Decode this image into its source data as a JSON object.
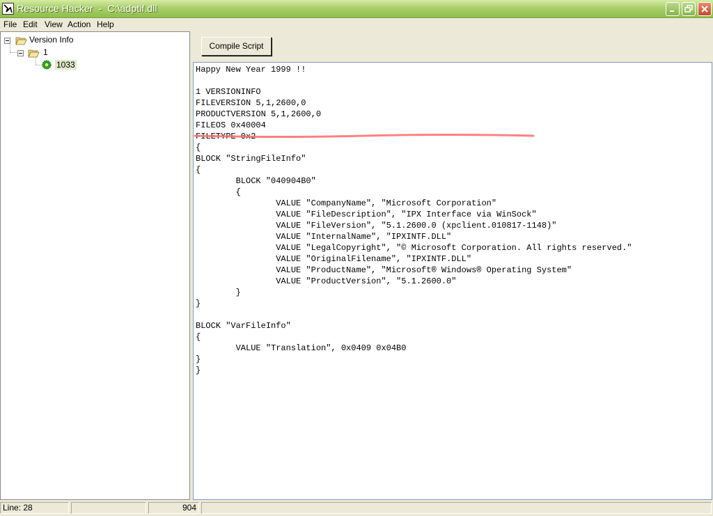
{
  "window": {
    "title": "Resource Hacker  -  C:\\adptif.dll"
  },
  "menu": {
    "file": "File",
    "edit": "Edit",
    "view": "View",
    "action": "Action",
    "help": "Help"
  },
  "tree": {
    "root": "Version Info",
    "child": "1",
    "leaf": "1033"
  },
  "toolbar": {
    "compile_label": "Compile Script"
  },
  "editor": {
    "lines": [
      "Happy New Year 1999 !!",
      "",
      "1 VERSIONINFO",
      "FILEVERSION 5,1,2600,0",
      "PRODUCTVERSION 5,1,2600,0",
      "FILEOS 0x40004",
      "FILETYPE 0x2",
      "{",
      "BLOCK \"StringFileInfo\"",
      "{",
      "\tBLOCK \"040904B0\"",
      "\t{",
      "\t\tVALUE \"CompanyName\", \"Microsoft Corporation\"",
      "\t\tVALUE \"FileDescription\", \"IPX Interface via WinSock\"",
      "\t\tVALUE \"FileVersion\", \"5.1.2600.0 (xpclient.010817-1148)\"",
      "\t\tVALUE \"InternalName\", \"IPXINTF.DLL\"",
      "\t\tVALUE \"LegalCopyright\", \"© Microsoft Corporation. All rights reserved.\"",
      "\t\tVALUE \"OriginalFilename\", \"IPXINTF.DLL\"",
      "\t\tVALUE \"ProductName\", \"Microsoft® Windows® Operating System\"",
      "\t\tVALUE \"ProductVersion\", \"5.1.2600.0\"",
      "\t}",
      "}",
      "",
      "BLOCK \"VarFileInfo\"",
      "{",
      "\tVALUE \"Translation\", 0x0409 0x04B0",
      "}",
      "}"
    ]
  },
  "status": {
    "line": "Line: 28",
    "panel2": "",
    "count": "904",
    "panel4": ""
  },
  "colors": {
    "title_bar": "#9cc45c",
    "highlight_underline": "#ff6b6b",
    "tree_selection": "#dfe8c9"
  }
}
